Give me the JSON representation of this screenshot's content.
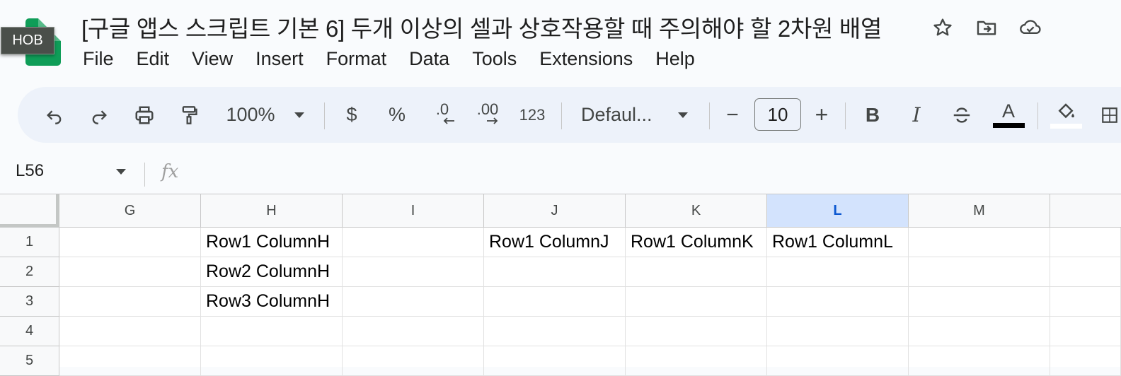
{
  "app": {
    "logo_badge": "HOB",
    "doc_title": "[구글 앱스 스크립트 기본 6] 두개 이상의 셀과 상호작용할 때 주의해야 할 2차원 배열",
    "title_icons": [
      "star-icon",
      "move-to-folder-icon",
      "cloud-saved-icon"
    ]
  },
  "menu": [
    "File",
    "Edit",
    "View",
    "Insert",
    "Format",
    "Data",
    "Tools",
    "Extensions",
    "Help"
  ],
  "toolbar": {
    "zoom": "100%",
    "currency": "$",
    "percent": "%",
    "decrease_decimal": ".0",
    "increase_decimal": ".00",
    "more_formats": "123",
    "font": "Defaul...",
    "font_size": "10",
    "minus": "−",
    "plus": "+",
    "bold": "B",
    "italic": "I",
    "text_color": "A",
    "text_color_value": "#000000"
  },
  "formula_bar": {
    "name_box": "L56",
    "fx": "fx",
    "value": ""
  },
  "grid": {
    "columns": [
      "G",
      "H",
      "I",
      "J",
      "K",
      "L",
      "M"
    ],
    "active_column": "L",
    "rows": [
      "1",
      "2",
      "3",
      "4",
      "5"
    ],
    "cells": [
      [
        "",
        "Row1 ColumnH",
        "",
        "Row1 ColumnJ",
        "Row1 ColumnK",
        "Row1 ColumnL",
        ""
      ],
      [
        "",
        "Row2 ColumnH",
        "",
        "",
        "",
        "",
        ""
      ],
      [
        "",
        "Row3 ColumnH",
        "",
        "",
        "",
        "",
        ""
      ],
      [
        "",
        "",
        "",
        "",
        "",
        "",
        ""
      ],
      [
        "",
        "",
        "",
        "",
        "",
        "",
        ""
      ]
    ]
  },
  "colors": {
    "brand": "#0f9d58",
    "active_header_bg": "#d3e3fd",
    "active_header_text": "#0b57d0"
  }
}
